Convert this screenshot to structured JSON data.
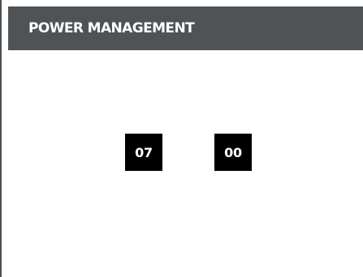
{
  "header": {
    "title": "POWER MANAGEMENT"
  },
  "time": {
    "hours": "07",
    "minutes": "00"
  },
  "colors": {
    "header_bg": "#505356",
    "header_text": "#ffffff",
    "box_bg": "#000000",
    "box_text": "#ffffff",
    "page_bg": "#ffffff"
  }
}
